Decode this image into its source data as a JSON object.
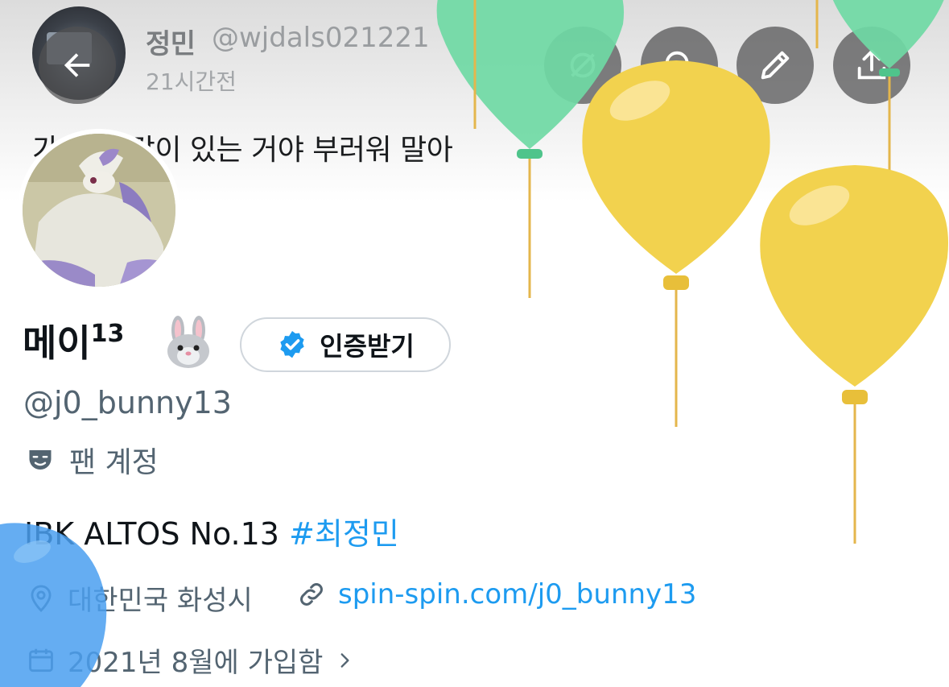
{
  "pinned_tweet": {
    "author_name": "정민",
    "author_handle": "@wjdals021221",
    "time": "21시간전",
    "text": "가 너도 같이 있는 거야 부러워 말아"
  },
  "header_actions": [
    "back-icon",
    "grok-icon",
    "search-icon",
    "edit-icon",
    "share-icon"
  ],
  "profile": {
    "display_name": "메이",
    "name_superscript": "13",
    "name_emoji": "rabbit-face",
    "verify_button_label": "인증받기",
    "handle": "@j0_bunny13",
    "account_type": "팬 계정",
    "bio_text": "IBK ALTOS No.13 ",
    "bio_hashtag": "#최정민",
    "location": "대한민국 화성시",
    "website": "spin-spin.com/j0_bunny13",
    "joined": "2021년 8월에 가입함"
  },
  "colors": {
    "accent": "#1d9bf0",
    "secondary_text": "#536471",
    "balloon_green": "#6fd9a4",
    "balloon_yellow": "#f2d24e",
    "balloon_blue": "#4a9ff0"
  }
}
